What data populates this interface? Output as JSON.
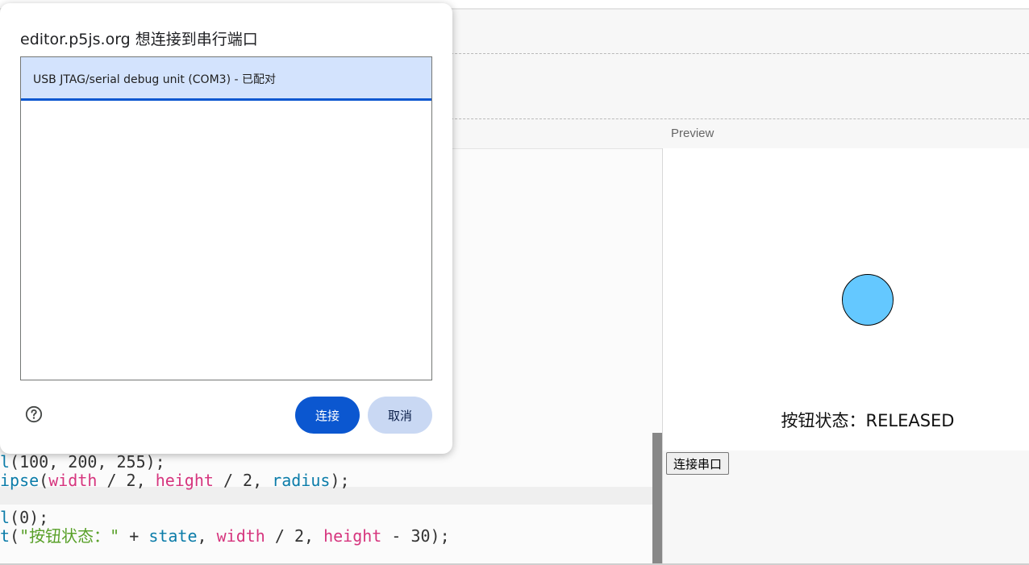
{
  "dialog": {
    "title": "editor.p5js.org 想连接到串行端口",
    "devices": [
      {
        "label": "USB JTAG/serial debug unit (COM3) - 已配对",
        "selected": true
      }
    ],
    "connect_label": "连接",
    "cancel_label": "取消",
    "help_icon": "help-circle-icon"
  },
  "preview": {
    "label": "Preview",
    "state_text": "按钮状态：RELEASED",
    "connect_serial_label": "连接串口",
    "circle_color": "#64c8ff"
  },
  "code": {
    "lines": [
      [
        {
          "t": "l",
          "c": "fn"
        },
        {
          "t": "(100, 200, 255);",
          "c": "pl"
        }
      ],
      [
        {
          "t": "ipse",
          "c": "fn"
        },
        {
          "t": "(",
          "c": "pl"
        },
        {
          "t": "width",
          "c": "kw"
        },
        {
          "t": " / 2, ",
          "c": "pl"
        },
        {
          "t": "height",
          "c": "kw"
        },
        {
          "t": " / 2, ",
          "c": "pl"
        },
        {
          "t": "radius",
          "c": "fn"
        },
        {
          "t": ");",
          "c": "pl"
        }
      ],
      [],
      [
        {
          "t": "l",
          "c": "fn"
        },
        {
          "t": "(0);",
          "c": "pl"
        }
      ],
      [
        {
          "t": "t",
          "c": "fn"
        },
        {
          "t": "(",
          "c": "pl"
        },
        {
          "t": "\"按钮状态：\"",
          "c": "str"
        },
        {
          "t": " + ",
          "c": "pl"
        },
        {
          "t": "state",
          "c": "fn"
        },
        {
          "t": ", ",
          "c": "pl"
        },
        {
          "t": "width",
          "c": "kw"
        },
        {
          "t": " / 2, ",
          "c": "pl"
        },
        {
          "t": "height",
          "c": "kw"
        },
        {
          "t": " - 30);",
          "c": "pl"
        }
      ]
    ]
  },
  "colors": {
    "primary": "#0b57d0",
    "selected_row": "#d3e3fd",
    "secondary_button": "#c9d8f3"
  }
}
